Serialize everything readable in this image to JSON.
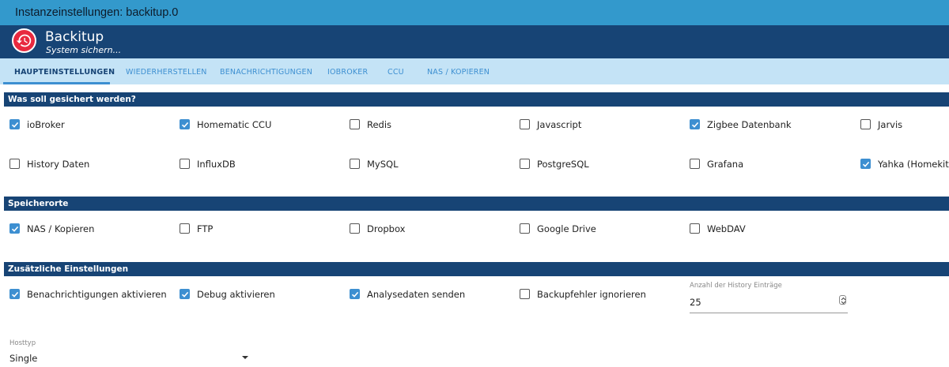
{
  "window": {
    "title": "Instanzeinstellungen: backitup.0"
  },
  "app": {
    "name": "Backitup",
    "subtitle": "System sichern..."
  },
  "tabs": [
    {
      "label": "HAUPTEINSTELLUNGEN",
      "active": true
    },
    {
      "label": "WIEDERHERSTELLEN",
      "active": false
    },
    {
      "label": "BENACHRICHTIGUNGEN",
      "active": false
    },
    {
      "label": "IOBROKER",
      "active": false
    },
    {
      "label": "CCU",
      "active": false
    },
    {
      "label": "NAS / KOPIEREN",
      "active": false
    }
  ],
  "sections": {
    "backup": {
      "title": "Was soll gesichert werden?",
      "items": [
        {
          "label": "ioBroker",
          "checked": true
        },
        {
          "label": "Homematic CCU",
          "checked": true
        },
        {
          "label": "Redis",
          "checked": false
        },
        {
          "label": "Javascript",
          "checked": false
        },
        {
          "label": "Zigbee Datenbank",
          "checked": true
        },
        {
          "label": "Jarvis",
          "checked": false
        },
        {
          "label": "History Daten",
          "checked": false
        },
        {
          "label": "InfluxDB",
          "checked": false
        },
        {
          "label": "MySQL",
          "checked": false
        },
        {
          "label": "PostgreSQL",
          "checked": false
        },
        {
          "label": "Grafana",
          "checked": false
        },
        {
          "label": "Yahka (Homekit)",
          "checked": true
        }
      ]
    },
    "storage": {
      "title": "Speicherorte",
      "items": [
        {
          "label": "NAS / Kopieren",
          "checked": true
        },
        {
          "label": "FTP",
          "checked": false
        },
        {
          "label": "Dropbox",
          "checked": false
        },
        {
          "label": "Google Drive",
          "checked": false
        },
        {
          "label": "WebDAV",
          "checked": false
        }
      ]
    },
    "extra": {
      "title": "Zusätzliche Einstellungen",
      "items": [
        {
          "label": "Benachrichtigungen aktivieren",
          "checked": true
        },
        {
          "label": "Debug aktivieren",
          "checked": true
        },
        {
          "label": "Analysedaten senden",
          "checked": true
        },
        {
          "label": "Backupfehler ignorieren",
          "checked": false
        }
      ],
      "history_count": {
        "label": "Anzahl der History Einträge",
        "value": "25"
      },
      "host_type": {
        "label": "Hosttyp",
        "value": "Single"
      }
    }
  },
  "colors": {
    "header": "#174475",
    "titlebar": "#3399cc",
    "tabs_bg": "#c4e3f6",
    "accent": "#3d8fd1",
    "logo": "#e8293f"
  },
  "icons": {
    "logo": "history-clock-icon",
    "checkbox": "check-icon",
    "spinner": "up-down-icon",
    "select": "caret-down-icon"
  }
}
